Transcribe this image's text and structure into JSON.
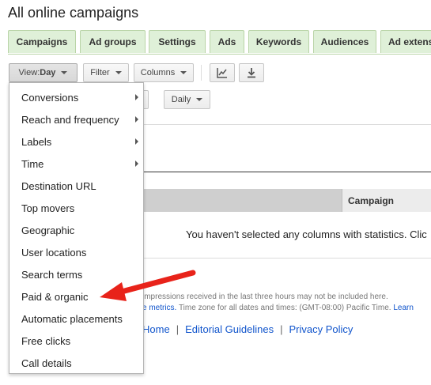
{
  "page": {
    "title": "All online campaigns"
  },
  "tabs": [
    "Campaigns",
    "Ad groups",
    "Settings",
    "Ads",
    "Keywords",
    "Audiences",
    "Ad extensio"
  ],
  "toolbar": {
    "view_label": "View: ",
    "view_value": "Day",
    "filter_label": "Filter",
    "columns_label": "Columns",
    "daily_label": "Daily"
  },
  "table": {
    "campaign_header": "Campaign"
  },
  "empty_message": "You haven't selected any columns with statistics. Clic",
  "notes": {
    "line1": "impressions received in the last three hours may not be included here.",
    "line2_link": "e metrics.",
    "line2_text": " Time zone for all dates and times: (GMT-08:00) Pacific Time. ",
    "line2_link2": "Learn"
  },
  "footer": {
    "links": [
      "Home",
      "Editorial Guidelines",
      "Privacy Policy"
    ]
  },
  "view_menu": {
    "items": [
      {
        "label": "Conversions",
        "submenu": true
      },
      {
        "label": "Reach and frequency",
        "submenu": true
      },
      {
        "label": "Labels",
        "submenu": true
      },
      {
        "label": "Time",
        "submenu": true
      },
      {
        "label": "Destination URL",
        "submenu": false
      },
      {
        "label": "Top movers",
        "submenu": false
      },
      {
        "label": "Geographic",
        "submenu": false
      },
      {
        "label": "User locations",
        "submenu": false
      },
      {
        "label": "Search terms",
        "submenu": false
      },
      {
        "label": "Paid & organic",
        "submenu": false
      },
      {
        "label": "Automatic placements",
        "submenu": false
      },
      {
        "label": "Free clicks",
        "submenu": false
      },
      {
        "label": "Call details",
        "submenu": false
      }
    ]
  },
  "annotation": {
    "arrow_color": "#e8231a",
    "icon": "red-arrow-icon"
  },
  "colors": {
    "tab_bg": "#dff0d8",
    "link": "#1155cc"
  }
}
